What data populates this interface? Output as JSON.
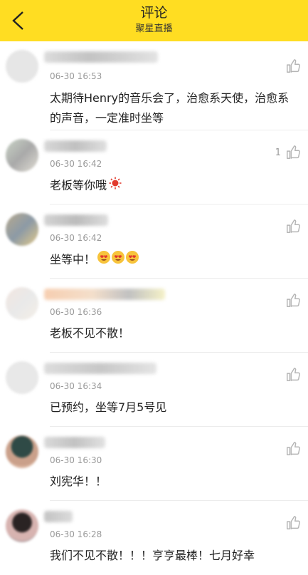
{
  "header": {
    "title": "评论",
    "subtitle": "聚星直播",
    "background": "#FFDD22"
  },
  "comments": [
    {
      "time": "06-30 16:53",
      "text": "太期待Henry的音乐会了，治愈系天使，治愈系的声音，一定准时坐等",
      "likes": "",
      "emoji": ""
    },
    {
      "time": "06-30 16:42",
      "text": "老板等你哦",
      "likes": "1",
      "emoji": "sun"
    },
    {
      "time": "06-30 16:42",
      "text": "坐等中！",
      "likes": "",
      "emoji": "heart-eyes-x3"
    },
    {
      "time": "06-30 16:36",
      "text": "老板不见不散！",
      "likes": "",
      "emoji": ""
    },
    {
      "time": "06-30 16:34",
      "text": "已预约，坐等7月5号见",
      "likes": "",
      "emoji": ""
    },
    {
      "time": "06-30 16:30",
      "text": "刘宪华！！",
      "likes": "",
      "emoji": ""
    },
    {
      "time": "06-30 16:28",
      "text": "我们不见不散！！！亨亨最棒！七月好幸",
      "likes": "",
      "emoji": ""
    }
  ],
  "icons": {
    "back": "chevron-left-icon",
    "like": "thumbs-up-icon"
  },
  "colors": {
    "time": "#999999",
    "text": "#222222",
    "accent": "#FFDD22"
  }
}
